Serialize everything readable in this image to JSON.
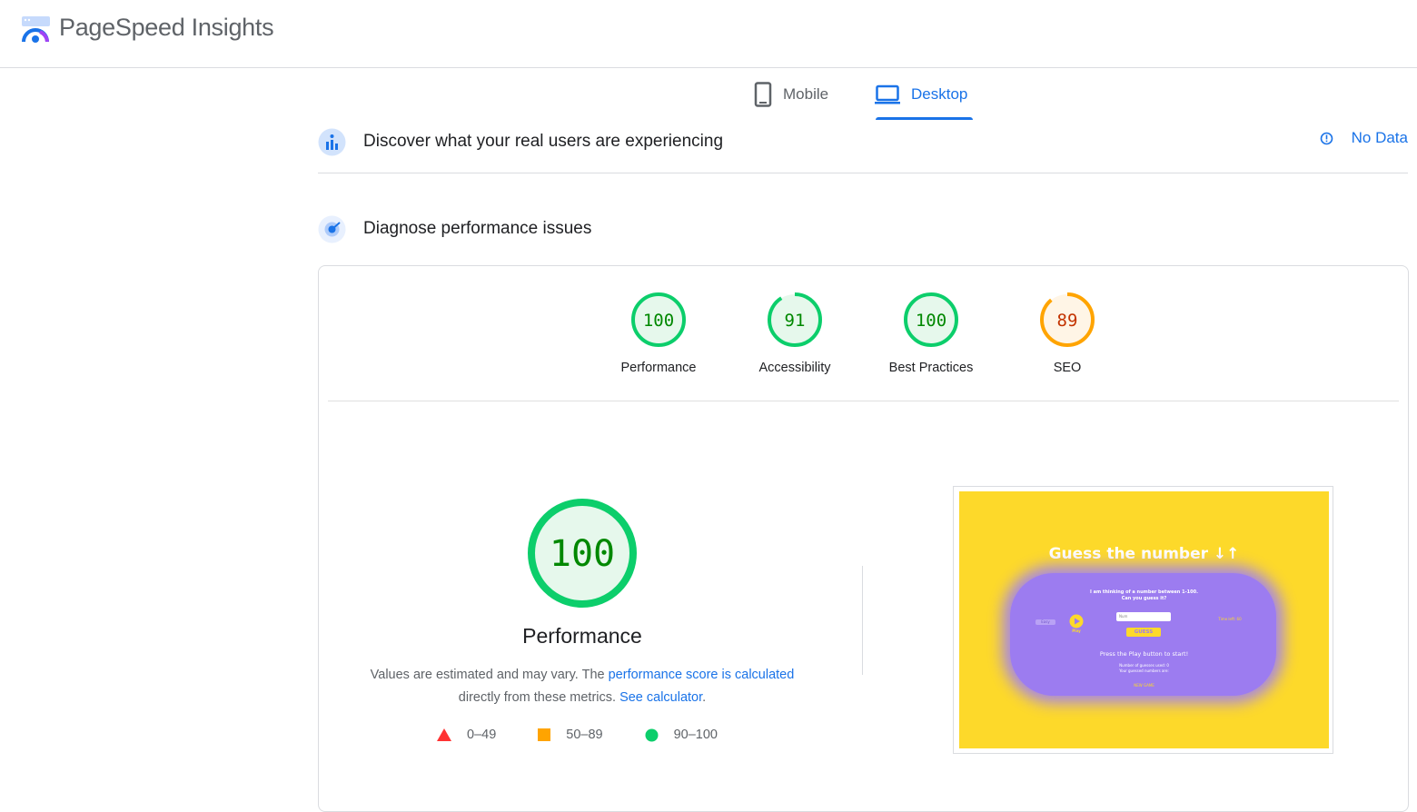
{
  "app": {
    "title": "PageSpeed Insights"
  },
  "tabs": [
    {
      "label": "Mobile",
      "icon": "phone-icon",
      "active": false
    },
    {
      "label": "Desktop",
      "icon": "laptop-icon",
      "active": true
    }
  ],
  "crux": {
    "title": "Discover what your real users are experiencing",
    "status": "No Data",
    "icon": "users-chart-icon"
  },
  "diagnose": {
    "title": "Diagnose performance issues",
    "icon": "radar-icon"
  },
  "scores": [
    {
      "label": "Performance",
      "value": "100",
      "fraction": 1.0,
      "color": "#0cce6b",
      "text_color": "#008800",
      "fill": "#e6f8ec"
    },
    {
      "label": "Accessibility",
      "value": "91",
      "fraction": 0.91,
      "color": "#0cce6b",
      "text_color": "#008800",
      "fill": "#e6f8ec"
    },
    {
      "label": "Best Practices",
      "value": "100",
      "fraction": 1.0,
      "color": "#0cce6b",
      "text_color": "#008800",
      "fill": "#e6f8ec"
    },
    {
      "label": "SEO",
      "value": "89",
      "fraction": 0.89,
      "color": "#ffa400",
      "text_color": "#c33300",
      "fill": "#fff5e6"
    }
  ],
  "performance": {
    "score": "100",
    "title": "Performance",
    "desc_prefix": "Values are estimated and may vary. The ",
    "desc_link1": "performance score is calculated",
    "desc_middle": " directly from these metrics. ",
    "desc_link2": "See calculator",
    "desc_suffix": "."
  },
  "legend": [
    {
      "range": "0–49",
      "shape": "triangle",
      "color": "#ff3333"
    },
    {
      "range": "50–89",
      "shape": "square",
      "color": "#ffa400"
    },
    {
      "range": "90–100",
      "shape": "circle",
      "color": "#0cce6b"
    }
  ],
  "screenshot": {
    "title": "Guess the number ↓↑",
    "prompt_line1": "I am thinking of a number between 1-100.",
    "prompt_line2": "Can you guess it?",
    "input_placeholder": "Num",
    "guess_button": "GUESS",
    "play_label": "Play",
    "level_select": "Easy",
    "timer": "Time left: 60",
    "status": "Press the Play button to start!",
    "guesses_used": "Number of guesses used: 0",
    "guesses_list": "Your guessed numbers are:",
    "new_game": "NEW GAME"
  }
}
